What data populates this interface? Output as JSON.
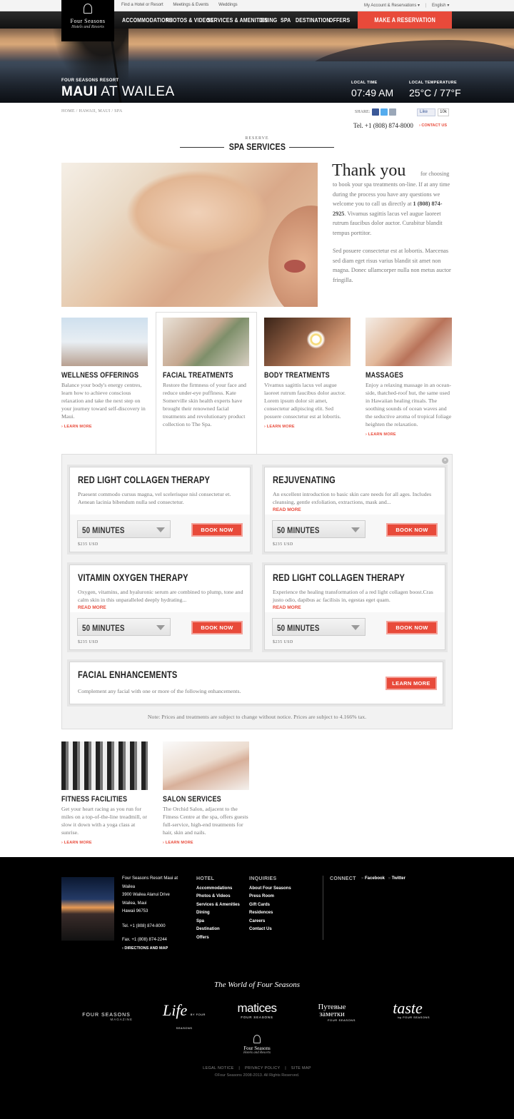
{
  "topbar": {
    "links": [
      "Find a Hotel or Resort",
      "Meetings & Events",
      "Weddings"
    ],
    "account": "My Account & Reservations",
    "language": "English"
  },
  "logo": {
    "name": "Four Seasons",
    "tagline": "Hotels and Resorts"
  },
  "nav": {
    "items": [
      "ACCOMMODATIONS",
      "PHOTOS & VIDEOS",
      "SERVICES & AMENITIES",
      "DINING",
      "SPA",
      "DESTINATION",
      "OFFERS"
    ],
    "reserve": "MAKE A RESERVATION"
  },
  "hero": {
    "subtitle": "FOUR SEASONS RESORT",
    "name_bold": "MAUI",
    "name_rest": " AT WAILEA",
    "time_label": "LOCAL TIME",
    "time_value": "07:49 AM",
    "temp_label": "LOCAL TEMPERATURE",
    "temp_value": "25°C / 77°F"
  },
  "breadcrumb": [
    "HOME",
    "HAWAII, MAUI",
    "SPA"
  ],
  "share": {
    "label": "SHARE:",
    "like": "Like",
    "like_count": "10k"
  },
  "contact": {
    "tel": "Tel. +1 (808) 874-8000",
    "link": "› CONTACT US"
  },
  "section": {
    "kicker": "RESERVE",
    "title": "SPA SERVICES"
  },
  "intro": {
    "heading": "Thank you",
    "lead": "for choosing",
    "p1a": "to book your spa treatments on-line. If at any time during the process you have any questions we welcome you to call us directly at ",
    "p1_phone": "1 (808) 874-2925",
    "p1b": ". Vivamus sagittis lacus vel augue laoreet rutrum faucibus dolor auctor. Curabitur blandit tempus porttitor.",
    "p2": "Sed posuere consectetur est at lobortis. Maecenas sed diam eget risus varius blandit sit amet non magna. Donec ullamcorper nulla non metus auctor fringilla."
  },
  "categories": [
    {
      "title": "WELLNESS OFFERINGS",
      "text": "Balance your body's energy centres, learn how to achieve conscious relaxation and take the next step on your journey toward self-discovery in Maui.",
      "more": "› LEARN MORE"
    },
    {
      "title": "FACIAL TREATMENTS",
      "text": "Restore the firmness of your face and reduce under-eye puffiness. Kate Somerville skin health experts have brought their renowned facial treatments and revolutionary product collection to The Spa."
    },
    {
      "title": "BODY TREATMENTS",
      "text": "Vivamus sagittis lacus vel augue laoreet rutrum faucibus dolor auctor. Lorem ipsum dolor sit amet, consectetur adipiscing elit. Sed posuere consectetur est at lobortis.",
      "more": "› LEARN MORE"
    },
    {
      "title": "MASSAGES",
      "text": "Enjoy a relaxing massage in an ocean-side, thatched-roof hut, the same used in Hawaiian healing rituals. The soothing sounds of ocean waves and the seductive aroma of tropical foliage heighten the relaxation.",
      "more": "› LEARN MORE"
    }
  ],
  "treatments": [
    {
      "title": "RED LIGHT COLLAGEN THERAPY",
      "desc": "Praesent commodo cursus magna, vel scelerisque nisl consectetur et. Aenean lacinia bibendum nulla sed consectetur.",
      "duration": "50 MINUTES",
      "price": "$235 USD",
      "cta": "BOOK NOW"
    },
    {
      "title": "REJUVENATING",
      "desc": "An excellent introduction to basic skin care needs for all ages. Includes cleansing, gentle exfoliation, extractions, mask and...",
      "more": "READ MORE",
      "duration": "50 MINUTES",
      "price": "$235 USD",
      "cta": "BOOK NOW"
    },
    {
      "title": "VITAMIN OXYGEN THERAPY",
      "desc": "Oxygen, vitamins, and hyaluronic serum are combined to plump, tone and calm skin in this unparalleled deeply hydrating...",
      "more": "READ MORE",
      "duration": "50 MINUTES",
      "price": "$235 USD",
      "cta": "BOOK NOW"
    },
    {
      "title": "RED LIGHT COLLAGEN THERAPY",
      "desc": "Experience the healing transformation of a red light collagen boost.Cras justo odio, dapibus ac facilisis in, egestas eget quam.",
      "more": "READ MORE",
      "duration": "50 MINUTES",
      "price": "$235 USD",
      "cta": "BOOK NOW"
    }
  ],
  "enhancements": {
    "title": "FACIAL ENHANCEMENTS",
    "desc": "Complement any facial with one or more of the following enhancements.",
    "cta": "LEARN MORE"
  },
  "note": "Note: Prices and treatments are subject to change without notice. Prices are subject to 4.166% tax.",
  "bottom_tiles": [
    {
      "title": "FITNESS FACILITIES",
      "text": "Get your heart racing as you run for miles on a top-of-the-line treadmill, or slow it down with a yoga class at sunrise.",
      "more": "› LEARN MORE"
    },
    {
      "title": "SALON SERVICES",
      "text": "The Orchid Salon, adjacent to the Fitness Centre at the spa, offers guests full-service, high-end treatments for hair, skin and nails.",
      "more": "› LEARN MORE"
    }
  ],
  "footer": {
    "address": [
      "Four Seasons Resort Maui at Wailea",
      "3900 Wailea Alanui Drive",
      "Wailea, Maui",
      "Hawaii 96753"
    ],
    "tel": "Tel. +1 (808) 874-8000",
    "fax": "Fax. +1 (808) 874-2244",
    "directions": "› DIRECTIONS AND MAP",
    "hotel_heading": "HOTEL",
    "hotel_links": [
      "Accommodations",
      "Photos & Videos",
      "Services & Amenities",
      "Dining",
      "Spa",
      "Destination",
      "Offers"
    ],
    "inquiries_heading": "INQUIRIES",
    "inquiries_links": [
      "About Four Seasons",
      "Press Room",
      "Gift Cards",
      "Residences",
      "Careers",
      "Contact Us"
    ],
    "connect_heading": "CONNECT",
    "social": [
      "Facebook",
      "Twitter"
    ],
    "world": "The World of Four Seasons",
    "brands": {
      "magazine_top": "FOUR SEASONS",
      "magazine_bottom": "MAGAZINE",
      "life": "Life",
      "life_sub": "BY FOUR SEASONS",
      "matices": "matices",
      "matices_sub": "FOUR SEASONS",
      "russian": "Путевые заметки",
      "russian_sub": "FOUR SEASONS",
      "taste": "taste",
      "taste_sub": "by FOUR SEASONS"
    },
    "logo_name": "Four Seasons",
    "logo_tagline": "Hotels and Resorts",
    "legal": [
      "LEGAL NOTICE",
      "PRIVACY POLICY",
      "SITE MAP"
    ],
    "copyright": "©Four Seasons 2008-2013. All Rights Reserved."
  },
  "colors": {
    "accent": "#e84a3a",
    "footer_bg": "#000000"
  }
}
